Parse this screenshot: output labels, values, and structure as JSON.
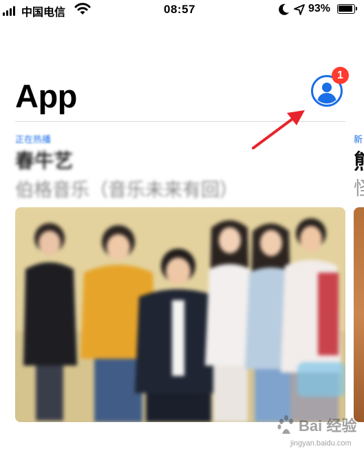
{
  "status_bar": {
    "carrier": "中国电信",
    "time": "08:57",
    "battery_percent": "93%",
    "battery_level": 0.93
  },
  "header": {
    "title": "App",
    "account_badge_count": "1"
  },
  "featured_card": {
    "eyebrow": "正在热播",
    "title": "春牛艺",
    "subtitle": "伯格音乐（音乐未来有回）"
  },
  "next_card": {
    "eyebrow": "新",
    "title": "熊",
    "subtitle": "怪"
  },
  "watermark": {
    "text": "Bai 经验",
    "url": "jingyan.baidu.com"
  },
  "colors": {
    "accent": "#1a6fe6",
    "badge": "#ff3b30",
    "annotation_arrow": "#e8232b"
  },
  "icons": {
    "signal": "cellular-signal-icon",
    "wifi": "wifi-icon",
    "do_not_disturb": "moon-icon",
    "location": "location-arrow-icon",
    "battery": "battery-icon",
    "account": "account-person-icon"
  }
}
